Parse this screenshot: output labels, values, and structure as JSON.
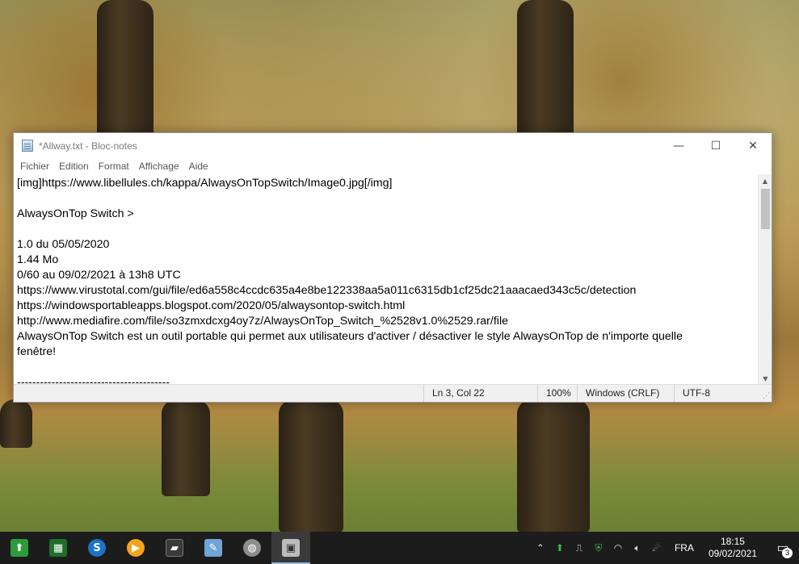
{
  "window": {
    "title": "*Allway.txt - Bloc-notes",
    "controls": {
      "minimize": "—",
      "maximize": "☐",
      "close": "✕"
    }
  },
  "menu": [
    "Fichier",
    "Edition",
    "Format",
    "Affichage",
    "Aide"
  ],
  "document_lines": [
    "[img]https://www.libellules.ch/kappa/AlwaysOnTopSwitch/Image0.jpg[/img]",
    "",
    "AlwaysOnTop Switch >",
    "",
    "1.0 du 05/05/2020",
    "1.44 Mo",
    "0/60 au 09/02/2021 à 13h8 UTC",
    "https://www.virustotal.com/gui/file/ed6a558c4ccdc635a4e8be122338aa5a011c6315db1cf25dc21aaacaed343c5c/detection",
    "https://windowsportableapps.blogspot.com/2020/05/alwaysontop-switch.html",
    "http://www.mediafire.com/file/so3zmxdcxg4oy7z/AlwaysOnTop_Switch_%2528v1.0%2529.rar/file",
    "AlwaysOnTop Switch est un outil portable qui permet aux utilisateurs d'activer / désactiver le style AlwaysOnTop de n'importe quelle",
    "fenêtre!",
    "",
    "----------------------------------------"
  ],
  "status": {
    "position": "Ln 3, Col 22",
    "zoom": "100%",
    "line_ending": "Windows (CRLF)",
    "encoding": "UTF-8"
  },
  "taskbar": {
    "apps": [
      {
        "name": "app-green-arrow",
        "icon": "green-arrow-icon",
        "color": "#2e9a3a",
        "glyph": "⬆"
      },
      {
        "name": "app-network",
        "icon": "network-icon",
        "color": "#1f6f2a",
        "glyph": "▦"
      },
      {
        "name": "app-s-blue",
        "icon": "s-logo-icon",
        "color": "#1a73c9",
        "glyph": "S"
      },
      {
        "name": "app-media-player",
        "icon": "play-icon",
        "color": "#f2a51c",
        "glyph": "▶"
      },
      {
        "name": "app-sticky-notes",
        "icon": "note-icon",
        "color": "#3a3a3a",
        "glyph": "▰"
      },
      {
        "name": "app-notepad-pad",
        "icon": "pad-icon",
        "color": "#6fa4d6",
        "glyph": "✎"
      },
      {
        "name": "app-globe",
        "icon": "globe-icon",
        "color": "#8d8d8d",
        "glyph": "◍"
      },
      {
        "name": "app-notepad-active",
        "icon": "monitor-icon",
        "color": "#bcbcbc",
        "glyph": "▣"
      }
    ],
    "tray": {
      "language": "FRA",
      "time": "18:15",
      "date": "09/02/2021",
      "notification_count": "3"
    }
  }
}
